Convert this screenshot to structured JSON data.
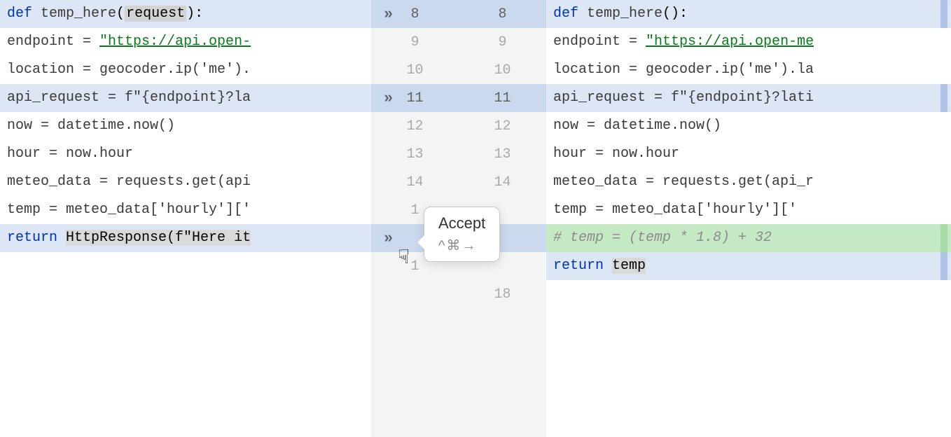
{
  "gutter": [
    {
      "l": "8",
      "r": "8",
      "hl": true,
      "chev": true
    },
    {
      "l": "9",
      "r": "9",
      "hl": false,
      "chev": false
    },
    {
      "l": "10",
      "r": "10",
      "hl": false,
      "chev": false
    },
    {
      "l": "11",
      "r": "11",
      "hl": true,
      "chev": true
    },
    {
      "l": "12",
      "r": "12",
      "hl": false,
      "chev": false
    },
    {
      "l": "13",
      "r": "13",
      "hl": false,
      "chev": false
    },
    {
      "l": "14",
      "r": "14",
      "hl": false,
      "chev": false
    },
    {
      "l": "1",
      "r": "",
      "hl": false,
      "chev": false
    },
    {
      "l": "",
      "r": "",
      "hl": true,
      "chev": true
    },
    {
      "l": "1",
      "r": "",
      "hl": false,
      "chev": false
    },
    {
      "l": "",
      "r": "18",
      "hl": false,
      "chev": false
    }
  ],
  "left": {
    "l1": {
      "def": "def ",
      "fn": "temp_here",
      "paren_open": "(",
      "param": "request",
      "paren_close": "):"
    },
    "l2": {
      "indent": "    ",
      "lhs": "endpoint = ",
      "url": "\"https://api.open-"
    },
    "l3": {
      "indent": "    ",
      "text": "location = geocoder.ip('me')."
    },
    "l4": {
      "indent": "    ",
      "text": "api_request = f\"{endpoint}?la"
    },
    "l5": {
      "indent": "    ",
      "text": "now = datetime.now()"
    },
    "l6": {
      "indent": "    ",
      "text": "hour = now.hour"
    },
    "l7": {
      "indent": "    ",
      "text": "meteo_data = requests.get(api"
    },
    "l8": {
      "indent": "    ",
      "text": "temp = meteo_data['hourly']['"
    },
    "l9": {
      "indent": "    ",
      "ret": "return ",
      "call": "HttpResponse",
      "rest": "(f\"Here it"
    }
  },
  "right": {
    "l1": {
      "def": "def ",
      "fn": "temp_here",
      "rest": "():"
    },
    "l2": {
      "indent": "    ",
      "lhs": "endpoint = ",
      "url": "\"https://api.open-me"
    },
    "l3": {
      "indent": "    ",
      "text": "location = geocoder.ip('me').la"
    },
    "l4": {
      "indent": "    ",
      "text": "api_request = f\"{endpoint}?lati"
    },
    "l5": {
      "indent": "    ",
      "text": "now = datetime.now()"
    },
    "l6": {
      "indent": "    ",
      "text": "hour = now.hour"
    },
    "l7": {
      "indent": "    ",
      "text": "meteo_data = requests.get(api_r"
    },
    "l8": {
      "indent": "    ",
      "text": "temp = meteo_data['hourly']['"
    },
    "l9": {
      "indent": "    ",
      "comment": "# temp = (temp * 1.8) + 32"
    },
    "l10": {
      "indent": "    ",
      "ret": "return ",
      "var": "temp"
    }
  },
  "tooltip": {
    "title": "Accept",
    "shortcut": "^⌘→"
  },
  "icons": {
    "chevron": "»",
    "hand": "☟"
  }
}
